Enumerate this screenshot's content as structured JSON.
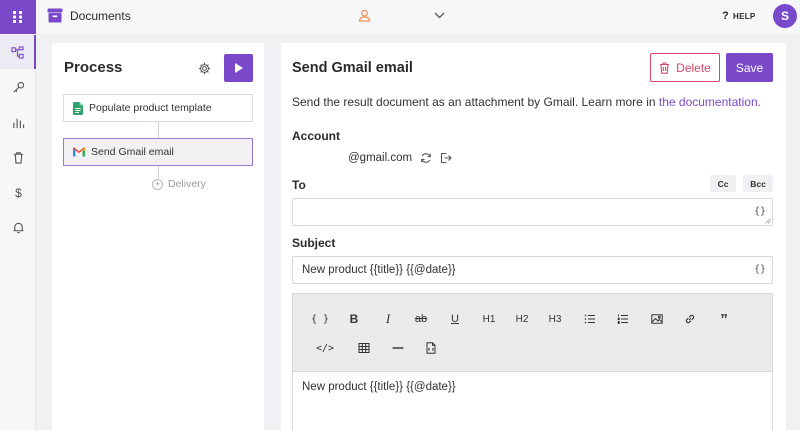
{
  "topbar": {
    "app_title": "Documents",
    "help_label": "HELP",
    "help_glyph": "?",
    "avatar_initial": "S",
    "icons": [
      "documents-box-icon",
      "user-icon",
      "chevron-down-icon",
      "help-icon"
    ]
  },
  "rail": {
    "icons": [
      "apps-grid-icon",
      "process-flow-icon",
      "key-icon",
      "bar-chart-icon",
      "trash-icon",
      "dollar-icon",
      "bell-icon"
    ],
    "active": "process-flow-icon"
  },
  "process": {
    "title": "Process",
    "steps": [
      {
        "label": "Populate product template",
        "icon": "google-docs-icon"
      },
      {
        "label": "Send Gmail email",
        "icon": "gmail-icon"
      }
    ],
    "add_label": "Delivery"
  },
  "detail": {
    "title": "Send Gmail email",
    "delete_label": "Delete",
    "save_label": "Save",
    "description": "Send the result document as an attachment by Gmail. Learn more in ",
    "doc_link": "the documentation.",
    "account_label": "Account",
    "account_value": "@gmail.com",
    "to_label": "To",
    "cc_label": "Cc",
    "bcc_label": "Bcc",
    "to_value": "",
    "subject_label": "Subject",
    "subject_value": "New product {{title}} {{@date}}",
    "braces_glyph": "{}",
    "editor_body": "New product {{title}} {{@date}}"
  },
  "toolbar": {
    "row1": [
      {
        "name": "variable-button",
        "text": "{ }"
      },
      {
        "name": "bold-button",
        "text": "B"
      },
      {
        "name": "italic-button",
        "text": "I"
      },
      {
        "name": "strikethrough-button",
        "text": "ab"
      },
      {
        "name": "underline-button",
        "text": "U"
      },
      {
        "name": "heading1-button",
        "text": "H1"
      },
      {
        "name": "heading2-button",
        "text": "H2"
      },
      {
        "name": "heading3-button",
        "text": "H3"
      },
      {
        "name": "bulleted-list-button",
        "text": ""
      },
      {
        "name": "numbered-list-button",
        "text": ""
      },
      {
        "name": "image-button",
        "text": ""
      },
      {
        "name": "link-button",
        "text": ""
      },
      {
        "name": "quote-button",
        "text": "”"
      }
    ],
    "row2": [
      {
        "name": "code-button",
        "text": "</>"
      },
      {
        "name": "table-button",
        "text": ""
      },
      {
        "name": "horizontal-rule-button",
        "text": ""
      },
      {
        "name": "insert-file-button",
        "text": ""
      }
    ]
  },
  "colors": {
    "accent": "#7a49c9",
    "danger": "#d84a6a",
    "user_icon": "#f0884a"
  }
}
